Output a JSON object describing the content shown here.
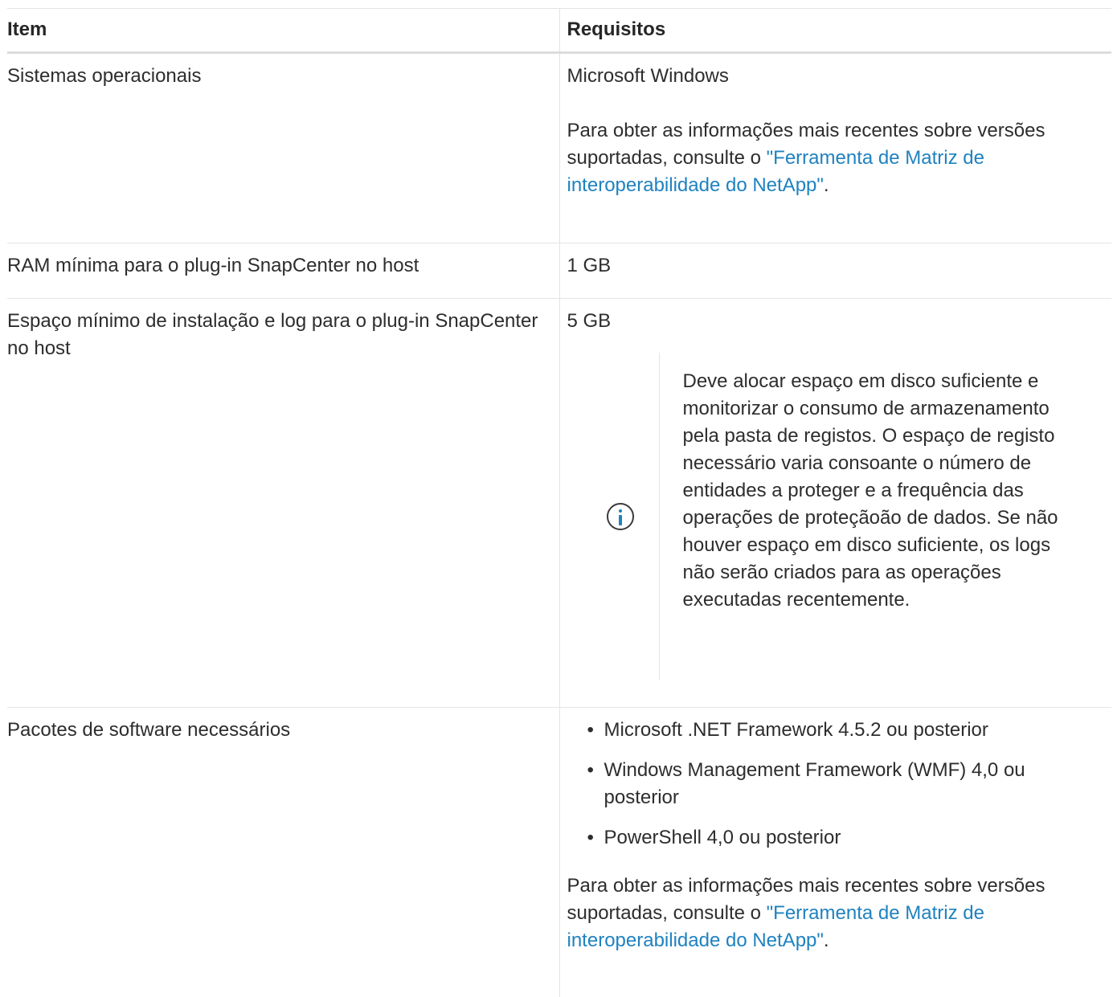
{
  "table": {
    "headers": {
      "item": "Item",
      "requirements": "Requisitos"
    },
    "rows": [
      {
        "item": "Sistemas operacionais",
        "req_line1": "Microsoft Windows",
        "req_para_text": "Para obter as informações mais recentes sobre versões suportadas, consulte o ",
        "req_link": "\"Ferramenta de Matriz de interoperabilidade do NetApp\"",
        "req_after": "."
      },
      {
        "item": "RAM mínima para o plug-in SnapCenter no host",
        "req_line1": "1 GB"
      },
      {
        "item": "Espaço mínimo de instalação e log para o plug-in SnapCenter no host",
        "req_line1": "5 GB",
        "note": {
          "icon": "info-icon",
          "text": "Deve alocar espaço em disco suficiente e monitorizar o consumo de armazenamento pela pasta de registos. O espaço de registo necessário varia consoante o número de entidades a proteger e a frequência das operações de proteçãoão de dados. Se não houver espaço em disco suficiente, os logs não serão criados para as operações executadas recentemente."
        }
      },
      {
        "item": "Pacotes de software necessários",
        "bullets": [
          "Microsoft .NET Framework 4.5.2 ou posterior",
          "Windows Management Framework (WMF) 4,0 ou posterior",
          "PowerShell 4,0 ou posterior"
        ],
        "req_para_text": "Para obter as informações mais recentes sobre versões suportadas, consulte o ",
        "req_link": "\"Ferramenta de Matriz de interoperabilidade do NetApp\"",
        "req_after": "."
      }
    ],
    "colors": {
      "link": "#1f82c0",
      "text": "#2d2d2d",
      "border": "#e4e4e4"
    }
  }
}
